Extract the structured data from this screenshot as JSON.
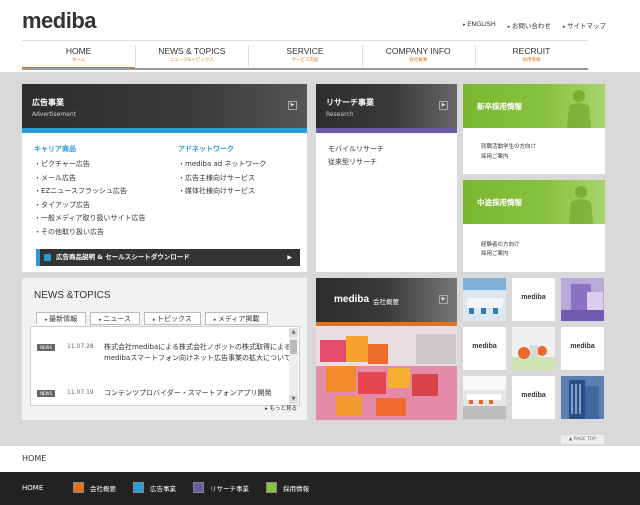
{
  "header": {
    "logo": "mediba",
    "links": [
      "ENGLISH",
      "お問い合わせ",
      "サイトマップ"
    ]
  },
  "nav": [
    {
      "label": "HOME",
      "sub": "ホーム"
    },
    {
      "label": "NEWS & TOPICS",
      "sub": "ニュース&トピックス"
    },
    {
      "label": "SERVICE",
      "sub": "サービス内容"
    },
    {
      "label": "COMPANY INFO",
      "sub": "会社概要"
    },
    {
      "label": "RECRUIT",
      "sub": "採用情報"
    }
  ],
  "ad": {
    "title": "広告事業",
    "subtitle": "Advertisement",
    "career_heading": "キャリア商品",
    "career_items": [
      "ピクチャー広告",
      "メール広告",
      "EZニュースフラッシュ広告",
      "タイアップ広告",
      "一般メディア取り扱いサイト広告",
      "その他取り扱い広告"
    ],
    "adnet_heading": "アドネットワーク",
    "adnet_items": [
      "mediba ad ネットワーク",
      "広告主様向けサービス",
      "媒体社様向けサービス"
    ],
    "download": "広告商品説明 & セールスシートダウンロード"
  },
  "research": {
    "title": "リサーチ事業",
    "subtitle": "Research",
    "items": [
      "モバイルリサーチ",
      "従来型リサーチ"
    ]
  },
  "recruit_new": {
    "title": "新卒採用情報",
    "items": [
      "就職活動学生の方向け",
      "採用ご案内"
    ]
  },
  "recruit_mid": {
    "title": "中途採用情報",
    "items": [
      "経験者の方向け",
      "採用ご案内"
    ]
  },
  "news": {
    "title": "NEWS &TOPICS",
    "tabs": [
      "最新情報",
      "ニュース",
      "トピックス",
      "メディア掲載"
    ],
    "rows": [
      {
        "badge": "NEWS",
        "date": "11.07.28",
        "text": "株式会社medibaによる株式会社ノボットの株式取得によるmedibaスマートフォン向けネット広告事業の拡大について"
      },
      {
        "badge": "NEWS",
        "date": "11.07.19",
        "text": "コンテンツプロバイダー・スマートフォンアプリ開発"
      }
    ],
    "more": "もっと見る"
  },
  "company": {
    "logo": "mediba",
    "subtitle": "会社概要"
  },
  "tiles": [
    "mediba",
    "mediba",
    "mediba",
    "mediba"
  ],
  "page_top": "PAGE TOP",
  "breadcrumb": "HOME",
  "footer": {
    "home": "HOME",
    "items": [
      {
        "label": "会社概要",
        "color": "#e2731c"
      },
      {
        "label": "広告事業",
        "color": "#2a9ad6"
      },
      {
        "label": "リサーチ事業",
        "color": "#6c5ba7"
      },
      {
        "label": "採用情報",
        "color": "#86c23d"
      }
    ]
  }
}
